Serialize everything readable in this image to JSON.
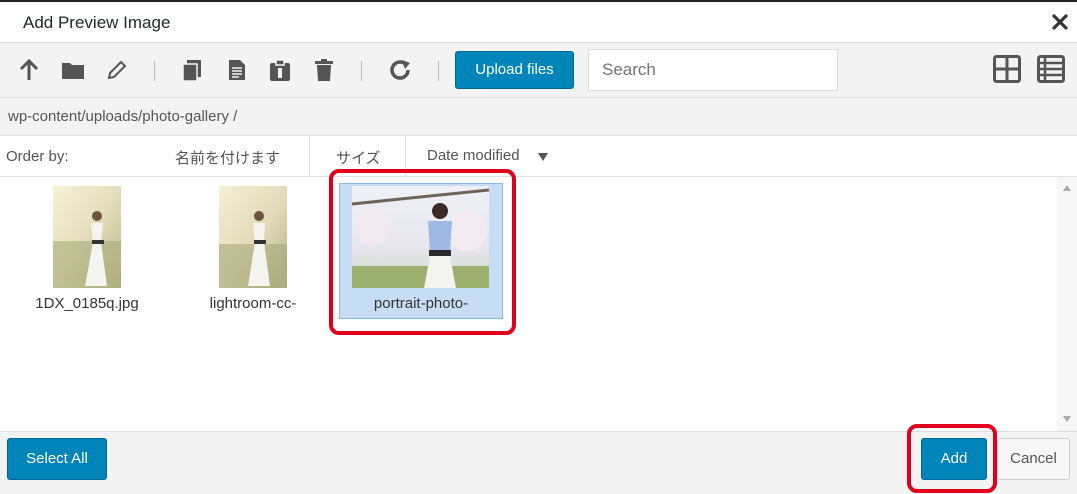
{
  "dialog": {
    "title": "Add Preview Image"
  },
  "toolbar": {
    "icons": [
      "up-arrow-icon",
      "folder-icon",
      "pencil-icon",
      "copy-icon",
      "document-icon",
      "paste-icon",
      "trash-icon",
      "refresh-icon"
    ],
    "upload_label": "Upload files",
    "search_placeholder": "Search",
    "view_icons": [
      "grid-view-icon",
      "list-view-icon"
    ]
  },
  "breadcrumb": {
    "path": "wp-content/uploads/photo-gallery",
    "separator": "/"
  },
  "order": {
    "label": "Order by:",
    "columns": [
      "名前を付けます",
      "サイズ",
      "Date modified"
    ]
  },
  "files": [
    {
      "name": "1DX_0185q.jpg",
      "selected": false
    },
    {
      "name": "lightroom-cc-",
      "selected": false
    },
    {
      "name": "portrait-photo-",
      "selected": true
    }
  ],
  "footer": {
    "select_all_label": "Select All",
    "add_label": "Add",
    "cancel_label": "Cancel"
  },
  "colors": {
    "accent": "#0085ba",
    "highlight": "#e0001a",
    "selection": "#c7ddf5"
  }
}
